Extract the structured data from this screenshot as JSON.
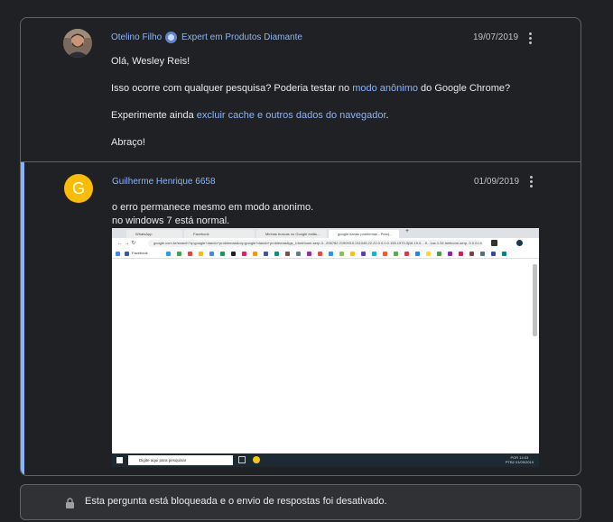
{
  "posts": [
    {
      "author": "Otelino Filho",
      "badge": "Expert em Produtos Diamante",
      "date": "19/07/2019",
      "greeting": "Olá, Wesley Reis!",
      "p2_before": "Isso ocorre com qualquer pesquisa? Poderia testar no ",
      "p2_link": "modo anônimo",
      "p2_after": " do Google Chrome?",
      "p3_before": "Experimente ainda ",
      "p3_link": "excluir cache e outros dados do navegador",
      "p3_after": ".",
      "closing": "Abraço!"
    },
    {
      "author": "Guilherme Henrique 6658",
      "avatar_letter": "G",
      "date": "01/09/2019",
      "line1": "o erro permanece mesmo em modo anonimo.",
      "line2": "no windows 7 está normal."
    }
  ],
  "screenshot": {
    "tabs": [
      "WhatsApp",
      "Facebook",
      "Minhas buscas no Google estão...",
      "google dando problemas - Pesq..."
    ],
    "new_tab": "+",
    "url": "google.com.br/search?q=google+dando+problemas&oq=google+dando+problemas&gs_l=heirloom-serp.3...206782.219093.0.211045.22.22.0.0.0.0.155.1970.3j16.19.0....0...1ac.1.34.heirloom-serp..3.0.0.Lhn3J_PD1-Q",
    "bookmark_label": "Facebook",
    "taskbar_search": "Digite aqui para pesquisar",
    "tray_lang": "POR",
    "tray_lang2": "PTB2",
    "tray_time": "14:03",
    "tray_date": "01/09/2019"
  },
  "locked_notice": "Esta pergunta está bloqueada e o envio de respostas foi desativado.",
  "colors": {
    "background": "#202124",
    "link": "#8ab4f8",
    "accent_border": "#8ab4f8",
    "avatar_g": "#fbbc04"
  },
  "icons": [
    "expert-badge-icon",
    "more-options-icon",
    "lock-icon"
  ]
}
